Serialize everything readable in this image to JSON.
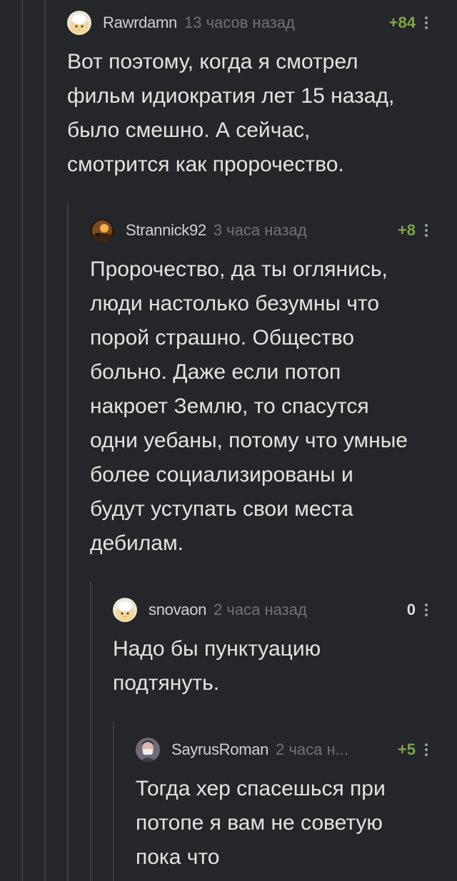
{
  "comments": [
    {
      "username": "Rawrdamn",
      "time": "13 часов назад",
      "rating": "+84",
      "avatar": "fluffy-chick-avatar",
      "lines": [
        "Вот поэтому, когда я смотрел",
        "фильм идиократия лет 15 назад,",
        "было смешно. А сейчас,",
        "смотрится как пророчество."
      ]
    },
    {
      "username": "Strannick92",
      "time": "3 часа назад",
      "rating": "+8",
      "avatar": "sunset-avatar",
      "lines": [
        "Пророчество, да ты оглянись,",
        "люди настолько безумны что",
        "порой страшно. Общество",
        "больно. Даже если потоп",
        "накроет Землю, то спасутся",
        "одни уебаны, потому что умные",
        "более социализированы и",
        "будут уступать свои места",
        "дебилам."
      ]
    },
    {
      "username": "snovaon",
      "time": "2 часа назад",
      "rating": "0",
      "avatar": "fluffy-chick-avatar",
      "lines": [
        "Надо бы пунктуацию",
        "подтянуть."
      ]
    },
    {
      "username": "SayrusRoman",
      "time": "2 часа н...",
      "rating": "+5",
      "avatar": "masked-person-avatar",
      "lines": [
        "Тогда хер спасешься при",
        "потопе я вам не советую",
        "пока что"
      ]
    }
  ],
  "colors": {
    "background": "#242629",
    "positive_rating": "#7ea646",
    "thread_line": "#3a3d41"
  }
}
